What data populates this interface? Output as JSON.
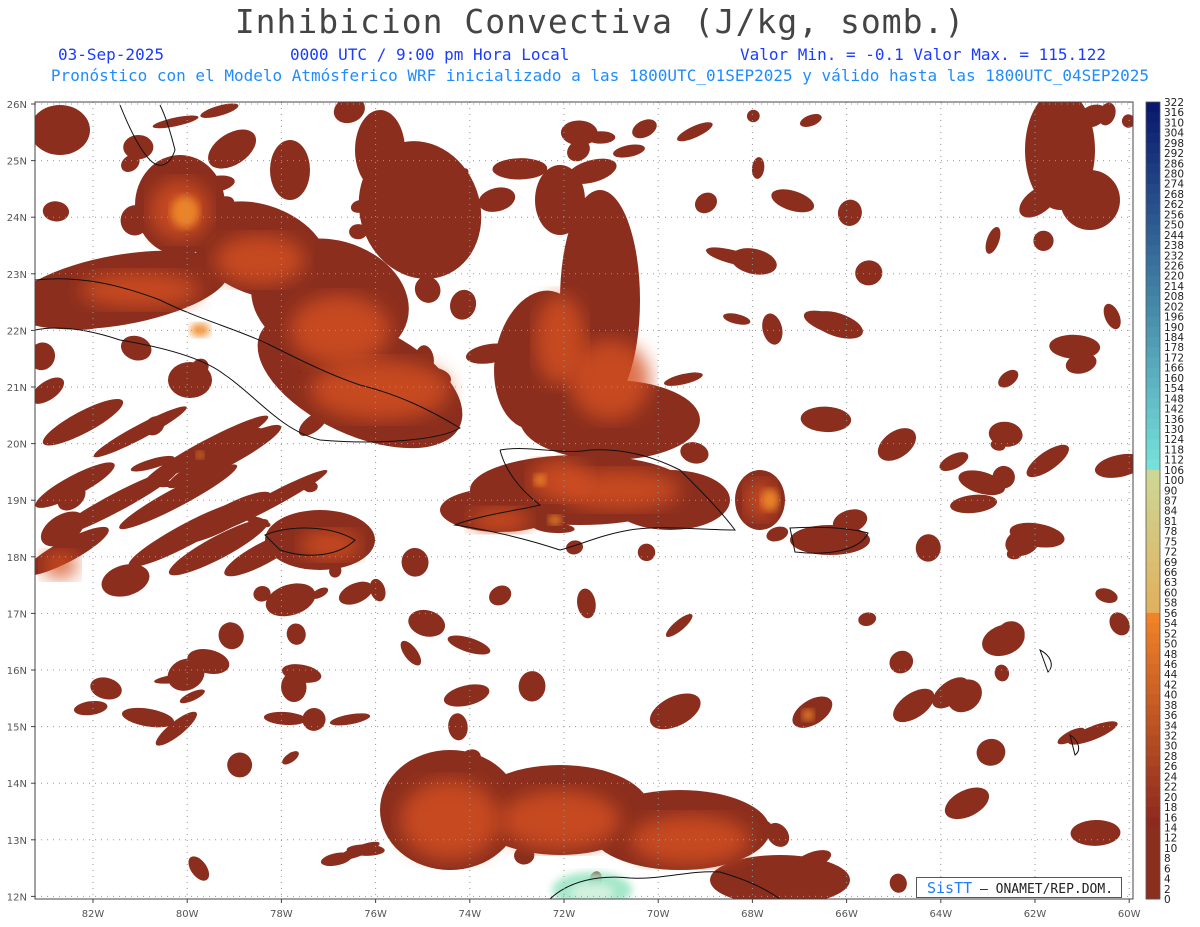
{
  "header": {
    "title": "Inhibicion Convectiva (J/kg, somb.)",
    "date": "03-Sep-2025",
    "time": "0000 UTC / 9:00 pm Hora Local",
    "minmax": "Valor Min. = -0.1  Valor Max. = 115.122",
    "model_info": "Pronóstico con el Modelo Atmósferico WRF inicializado a las 1800UTC_01SEP2025 y válido hasta las  1800UTC_04SEP2025"
  },
  "map": {
    "lat_labels": [
      "26N",
      "25N",
      "24N",
      "23N",
      "22N",
      "21N",
      "20N",
      "19N",
      "18N",
      "17N",
      "16N",
      "15N",
      "14N",
      "13N",
      "12N"
    ],
    "lon_labels": [
      "82W",
      "80W",
      "78W",
      "76W",
      "74W",
      "72W",
      "70W",
      "68W",
      "66W",
      "64W",
      "62W",
      "60W"
    ],
    "field_colors": {
      "low": "#8b2e1e",
      "mid": "#d4501e",
      "high": "#f08a2a",
      "peak": "#9fe6c6"
    }
  },
  "colorbar": {
    "labels": [
      "322",
      "316",
      "310",
      "304",
      "298",
      "292",
      "286",
      "280",
      "274",
      "268",
      "262",
      "256",
      "250",
      "244",
      "238",
      "232",
      "226",
      "220",
      "214",
      "208",
      "202",
      "196",
      "190",
      "184",
      "178",
      "172",
      "166",
      "160",
      "154",
      "148",
      "142",
      "136",
      "130",
      "124",
      "118",
      "112",
      "106",
      "100",
      "90",
      "87",
      "84",
      "81",
      "78",
      "75",
      "72",
      "69",
      "66",
      "63",
      "60",
      "58",
      "56",
      "54",
      "52",
      "50",
      "48",
      "46",
      "44",
      "42",
      "40",
      "38",
      "36",
      "34",
      "32",
      "30",
      "28",
      "26",
      "24",
      "22",
      "20",
      "18",
      "16",
      "14",
      "12",
      "10",
      "8",
      "6",
      "4",
      "2",
      "0"
    ]
  },
  "credit": {
    "brand": "SisTT",
    "text": " – ONAMET/REP.DOM."
  }
}
